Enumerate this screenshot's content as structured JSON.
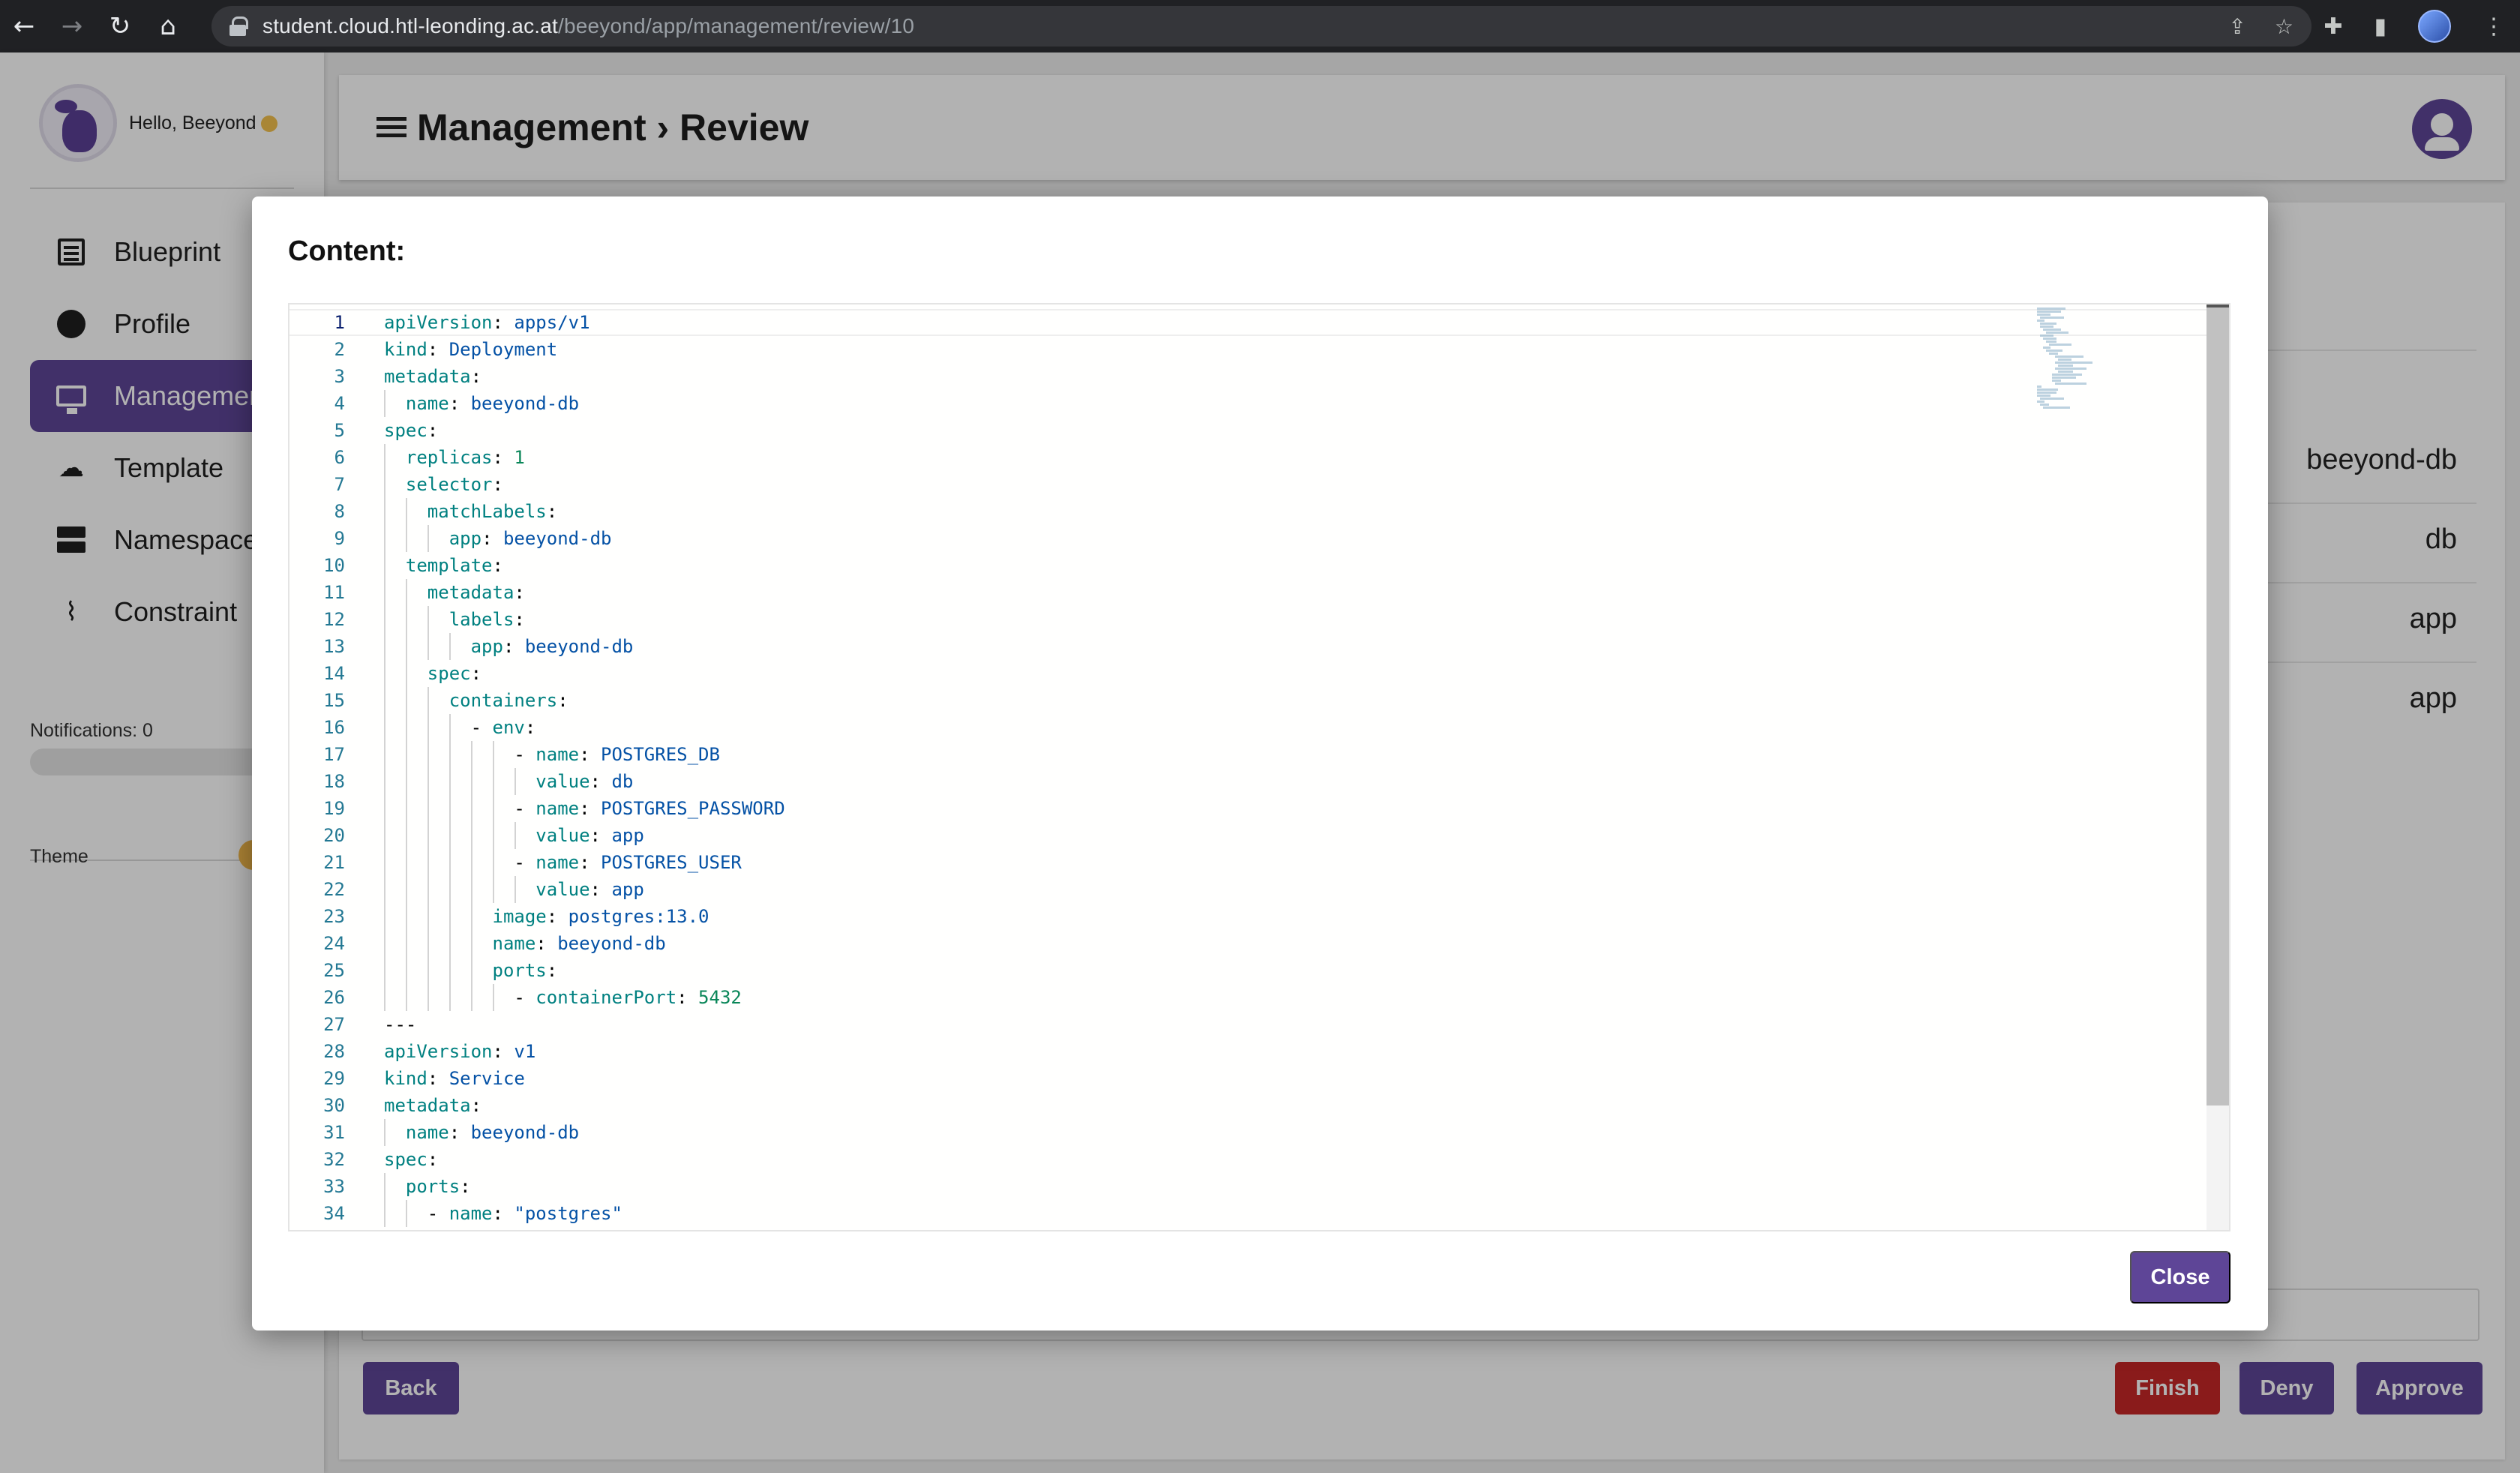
{
  "browser": {
    "url_host": "student.cloud.htl-leonding.ac.at",
    "url_path": "/beeyond/app/management/review/10",
    "back_icon": "arrow-left",
    "forward_icon": "arrow-right",
    "reload_icon": "reload",
    "home_icon": "home"
  },
  "sidebar": {
    "greeting": "Hello, Beeyond",
    "items": [
      {
        "label": "Blueprint",
        "icon": "list-icon"
      },
      {
        "label": "Profile",
        "icon": "account-icon"
      },
      {
        "label": "Management",
        "icon": "monitor-icon",
        "active": true
      },
      {
        "label": "Template",
        "icon": "template-icon"
      },
      {
        "label": "Namespace",
        "icon": "server-icon"
      },
      {
        "label": "Constraint",
        "icon": "paperclip-icon"
      }
    ],
    "notifications_label": "Notifications: 0",
    "theme_label": "Theme"
  },
  "header": {
    "title": "Management › Review"
  },
  "review_values": [
    "beeyond-db",
    "db",
    "app",
    "app"
  ],
  "actions": {
    "back": "Back",
    "finish": "Finish",
    "deny": "Deny",
    "approve": "Approve"
  },
  "dialog": {
    "title": "Content:",
    "close": "Close",
    "lines": [
      [
        [
          "k",
          "apiVersion"
        ],
        [
          "p",
          ": "
        ],
        [
          "v",
          "apps/v1"
        ]
      ],
      [
        [
          "k",
          "kind"
        ],
        [
          "p",
          ": "
        ],
        [
          "v",
          "Deployment"
        ]
      ],
      [
        [
          "k",
          "metadata"
        ],
        [
          "p",
          ":"
        ]
      ],
      [
        [
          "p",
          "  "
        ],
        [
          "k",
          "name"
        ],
        [
          "p",
          ": "
        ],
        [
          "v",
          "beeyond-db"
        ]
      ],
      [
        [
          "k",
          "spec"
        ],
        [
          "p",
          ":"
        ]
      ],
      [
        [
          "p",
          "  "
        ],
        [
          "k",
          "replicas"
        ],
        [
          "p",
          ": "
        ],
        [
          "n",
          "1"
        ]
      ],
      [
        [
          "p",
          "  "
        ],
        [
          "k",
          "selector"
        ],
        [
          "p",
          ":"
        ]
      ],
      [
        [
          "p",
          "    "
        ],
        [
          "k",
          "matchLabels"
        ],
        [
          "p",
          ":"
        ]
      ],
      [
        [
          "p",
          "      "
        ],
        [
          "k",
          "app"
        ],
        [
          "p",
          ": "
        ],
        [
          "v",
          "beeyond-db"
        ]
      ],
      [
        [
          "p",
          "  "
        ],
        [
          "k",
          "template"
        ],
        [
          "p",
          ":"
        ]
      ],
      [
        [
          "p",
          "    "
        ],
        [
          "k",
          "metadata"
        ],
        [
          "p",
          ":"
        ]
      ],
      [
        [
          "p",
          "      "
        ],
        [
          "k",
          "labels"
        ],
        [
          "p",
          ":"
        ]
      ],
      [
        [
          "p",
          "        "
        ],
        [
          "k",
          "app"
        ],
        [
          "p",
          ": "
        ],
        [
          "v",
          "beeyond-db"
        ]
      ],
      [
        [
          "p",
          "    "
        ],
        [
          "k",
          "spec"
        ],
        [
          "p",
          ":"
        ]
      ],
      [
        [
          "p",
          "      "
        ],
        [
          "k",
          "containers"
        ],
        [
          "p",
          ":"
        ]
      ],
      [
        [
          "p",
          "        - "
        ],
        [
          "k",
          "env"
        ],
        [
          "p",
          ":"
        ]
      ],
      [
        [
          "p",
          "            - "
        ],
        [
          "k",
          "name"
        ],
        [
          "p",
          ": "
        ],
        [
          "v",
          "POSTGRES_DB"
        ]
      ],
      [
        [
          "p",
          "              "
        ],
        [
          "k",
          "value"
        ],
        [
          "p",
          ": "
        ],
        [
          "v",
          "db"
        ]
      ],
      [
        [
          "p",
          "            - "
        ],
        [
          "k",
          "name"
        ],
        [
          "p",
          ": "
        ],
        [
          "v",
          "POSTGRES_PASSWORD"
        ]
      ],
      [
        [
          "p",
          "              "
        ],
        [
          "k",
          "value"
        ],
        [
          "p",
          ": "
        ],
        [
          "v",
          "app"
        ]
      ],
      [
        [
          "p",
          "            - "
        ],
        [
          "k",
          "name"
        ],
        [
          "p",
          ": "
        ],
        [
          "v",
          "POSTGRES_USER"
        ]
      ],
      [
        [
          "p",
          "              "
        ],
        [
          "k",
          "value"
        ],
        [
          "p",
          ": "
        ],
        [
          "v",
          "app"
        ]
      ],
      [
        [
          "p",
          "          "
        ],
        [
          "k",
          "image"
        ],
        [
          "p",
          ": "
        ],
        [
          "v",
          "postgres:13.0"
        ]
      ],
      [
        [
          "p",
          "          "
        ],
        [
          "k",
          "name"
        ],
        [
          "p",
          ": "
        ],
        [
          "v",
          "beeyond-db"
        ]
      ],
      [
        [
          "p",
          "          "
        ],
        [
          "k",
          "ports"
        ],
        [
          "p",
          ":"
        ]
      ],
      [
        [
          "p",
          "            - "
        ],
        [
          "k",
          "containerPort"
        ],
        [
          "p",
          ": "
        ],
        [
          "n",
          "5432"
        ]
      ],
      [
        [
          "p",
          "---"
        ]
      ],
      [
        [
          "k",
          "apiVersion"
        ],
        [
          "p",
          ": "
        ],
        [
          "v",
          "v1"
        ]
      ],
      [
        [
          "k",
          "kind"
        ],
        [
          "p",
          ": "
        ],
        [
          "v",
          "Service"
        ]
      ],
      [
        [
          "k",
          "metadata"
        ],
        [
          "p",
          ":"
        ]
      ],
      [
        [
          "p",
          "  "
        ],
        [
          "k",
          "name"
        ],
        [
          "p",
          ": "
        ],
        [
          "v",
          "beeyond-db"
        ]
      ],
      [
        [
          "k",
          "spec"
        ],
        [
          "p",
          ":"
        ]
      ],
      [
        [
          "p",
          "  "
        ],
        [
          "k",
          "ports"
        ],
        [
          "p",
          ":"
        ]
      ],
      [
        [
          "p",
          "    - "
        ],
        [
          "k",
          "name"
        ],
        [
          "p",
          ": "
        ],
        [
          "v",
          "\"postgres\""
        ]
      ]
    ]
  }
}
